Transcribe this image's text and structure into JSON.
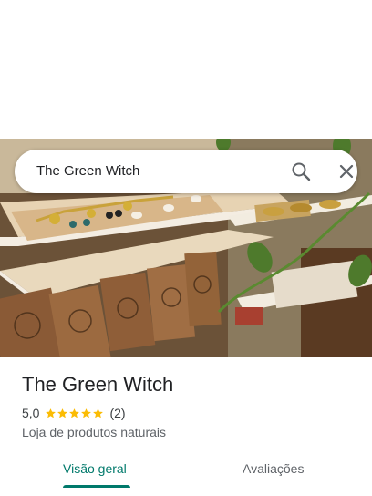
{
  "search": {
    "query": "The Green Witch"
  },
  "place": {
    "name": "The Green Witch",
    "rating": "5,0",
    "stars": 5,
    "review_count": "(2)",
    "category": "Loja de produtos naturais"
  },
  "tabs": [
    {
      "label": "Visão geral",
      "selected": true
    },
    {
      "label": "Avaliações",
      "selected": false
    }
  ],
  "colors": {
    "accent": "#00796b",
    "star": "#fbbc04",
    "text_primary": "#202124",
    "text_secondary": "#5f6368"
  },
  "icons": {
    "search": "search-icon",
    "close": "close-icon",
    "star": "star-icon"
  }
}
